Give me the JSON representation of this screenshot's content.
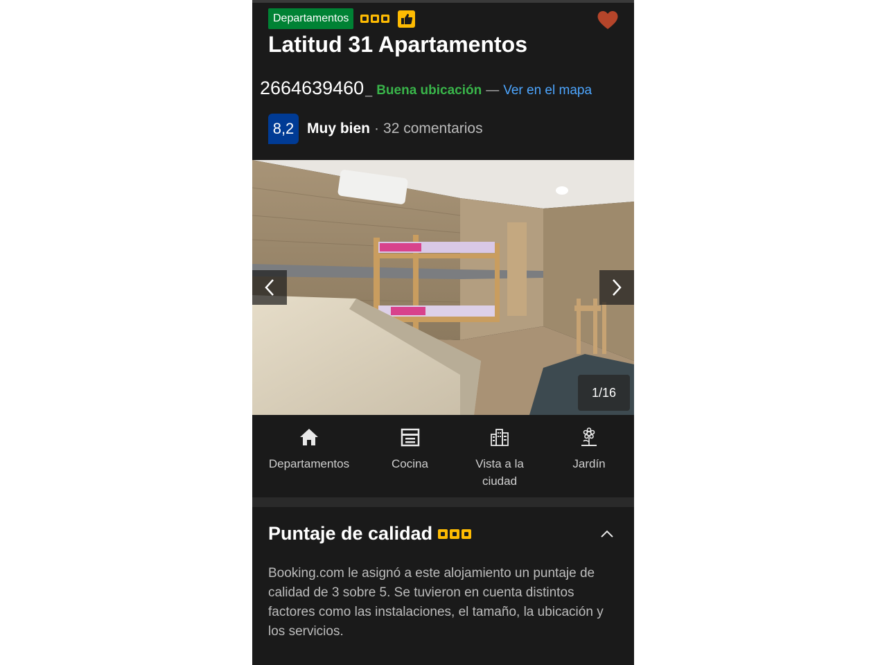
{
  "header": {
    "property_type": "Departamentos",
    "quality_stars": 3,
    "title": "Latitud 31 Apartamentos",
    "phone": "2664639460",
    "location_label": "Buena ubicación",
    "location_separator": "—",
    "map_link": "Ver en el mapa",
    "favorite_color": "#b5452a"
  },
  "rating": {
    "score": "8,2",
    "word": "Muy bien",
    "separator": "·",
    "reviews": "32 comentarios",
    "score_bg": "#003b95"
  },
  "gallery": {
    "counter": "1/16"
  },
  "facilities": [
    {
      "label": "Departamentos",
      "icon": "home-icon"
    },
    {
      "label": "Cocina",
      "icon": "kitchen-icon"
    },
    {
      "label": "Vista a la ciudad",
      "icon": "city-view-icon"
    },
    {
      "label": "Jardín",
      "icon": "garden-icon"
    }
  ],
  "quality_section": {
    "title": "Puntaje de calidad",
    "description": "Booking.com le asignó a este alojamiento un puntaje de calidad de 3 sobre 5. Se tuvieron en cuenta distintos factores como las instalaciones, el tamaño, la ubicación y los servicios."
  },
  "colors": {
    "background": "#1a1a1a",
    "badge_green": "#008234",
    "quality_yellow": "#febb02",
    "location_green": "#39b54a",
    "link_blue": "#4da6ff"
  }
}
